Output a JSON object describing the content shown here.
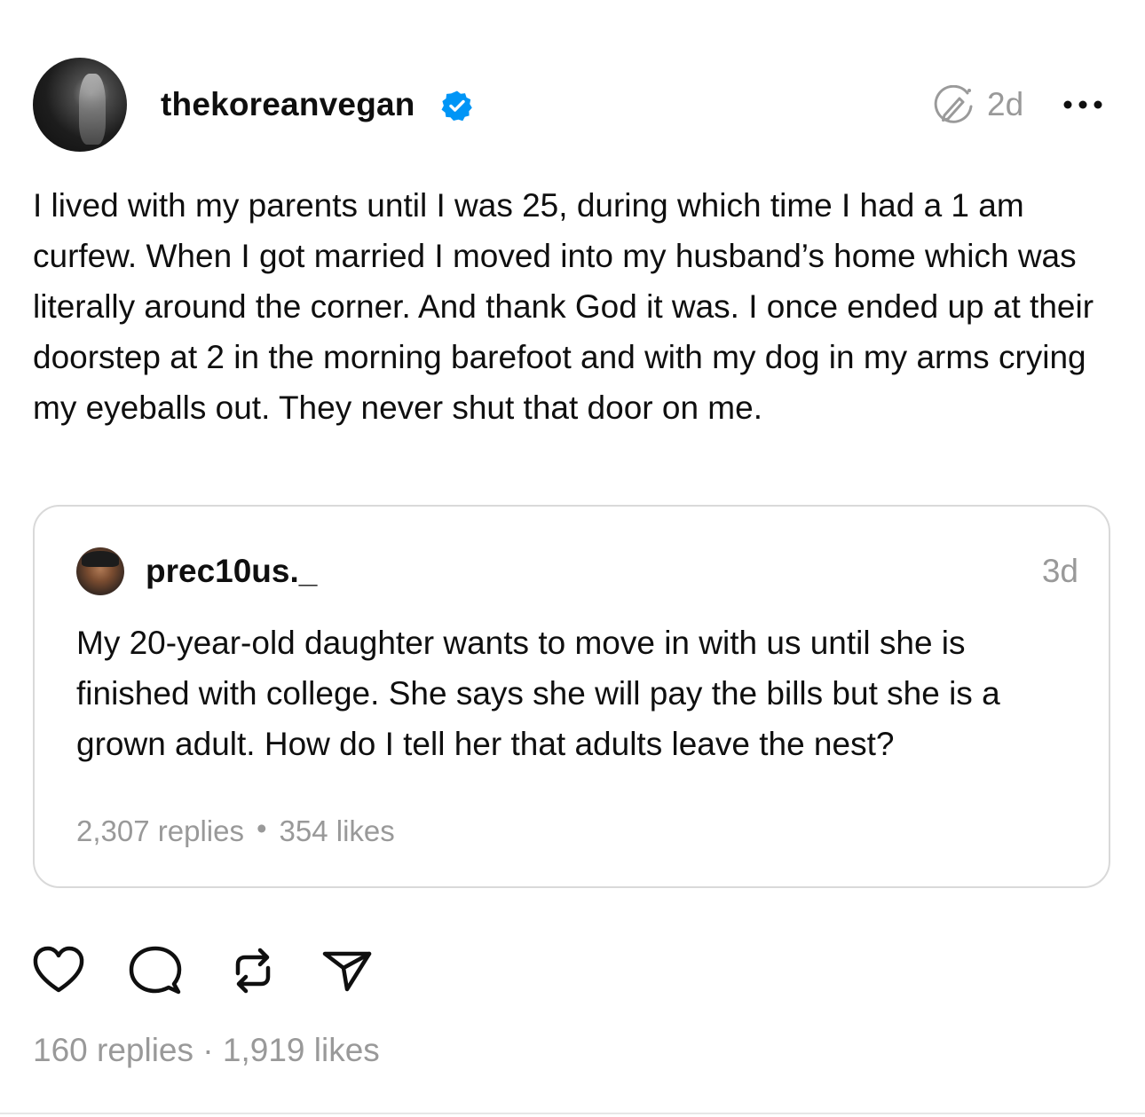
{
  "post": {
    "author": "thekoreanvegan",
    "verified": true,
    "time": "2d",
    "text": "I lived with my parents until I was 25, during which time I had a 1 am curfew. When I got married I moved into my husband’s home which was literally around the corner. And thank God it was. I once ended up at their doorstep at 2 in the morning barefoot and with my dog in my arms crying my eyeballs out. They never shut that door on me.",
    "replies": "160 replies",
    "separator": "·",
    "likes": "1,919 likes"
  },
  "quote": {
    "author": "prec10us._",
    "time": "3d",
    "text": "My 20-year-old daughter wants to move in with us until she is finished with college. She says she will pay the bills but she is a grown adult. How do I tell her that adults leave the nest?",
    "replies": "2,307 replies",
    "separator": "•",
    "likes": "354 likes"
  },
  "icons": {
    "verified": "verified-badge-icon",
    "edited": "edited-icon",
    "more": "more-icon",
    "like": "heart-icon",
    "reply": "comment-icon",
    "repost": "repost-icon",
    "share": "send-icon"
  },
  "colors": {
    "text": "#0f0f0f",
    "muted": "#999999",
    "verified": "#0095f6",
    "border": "#d9d9d9"
  }
}
